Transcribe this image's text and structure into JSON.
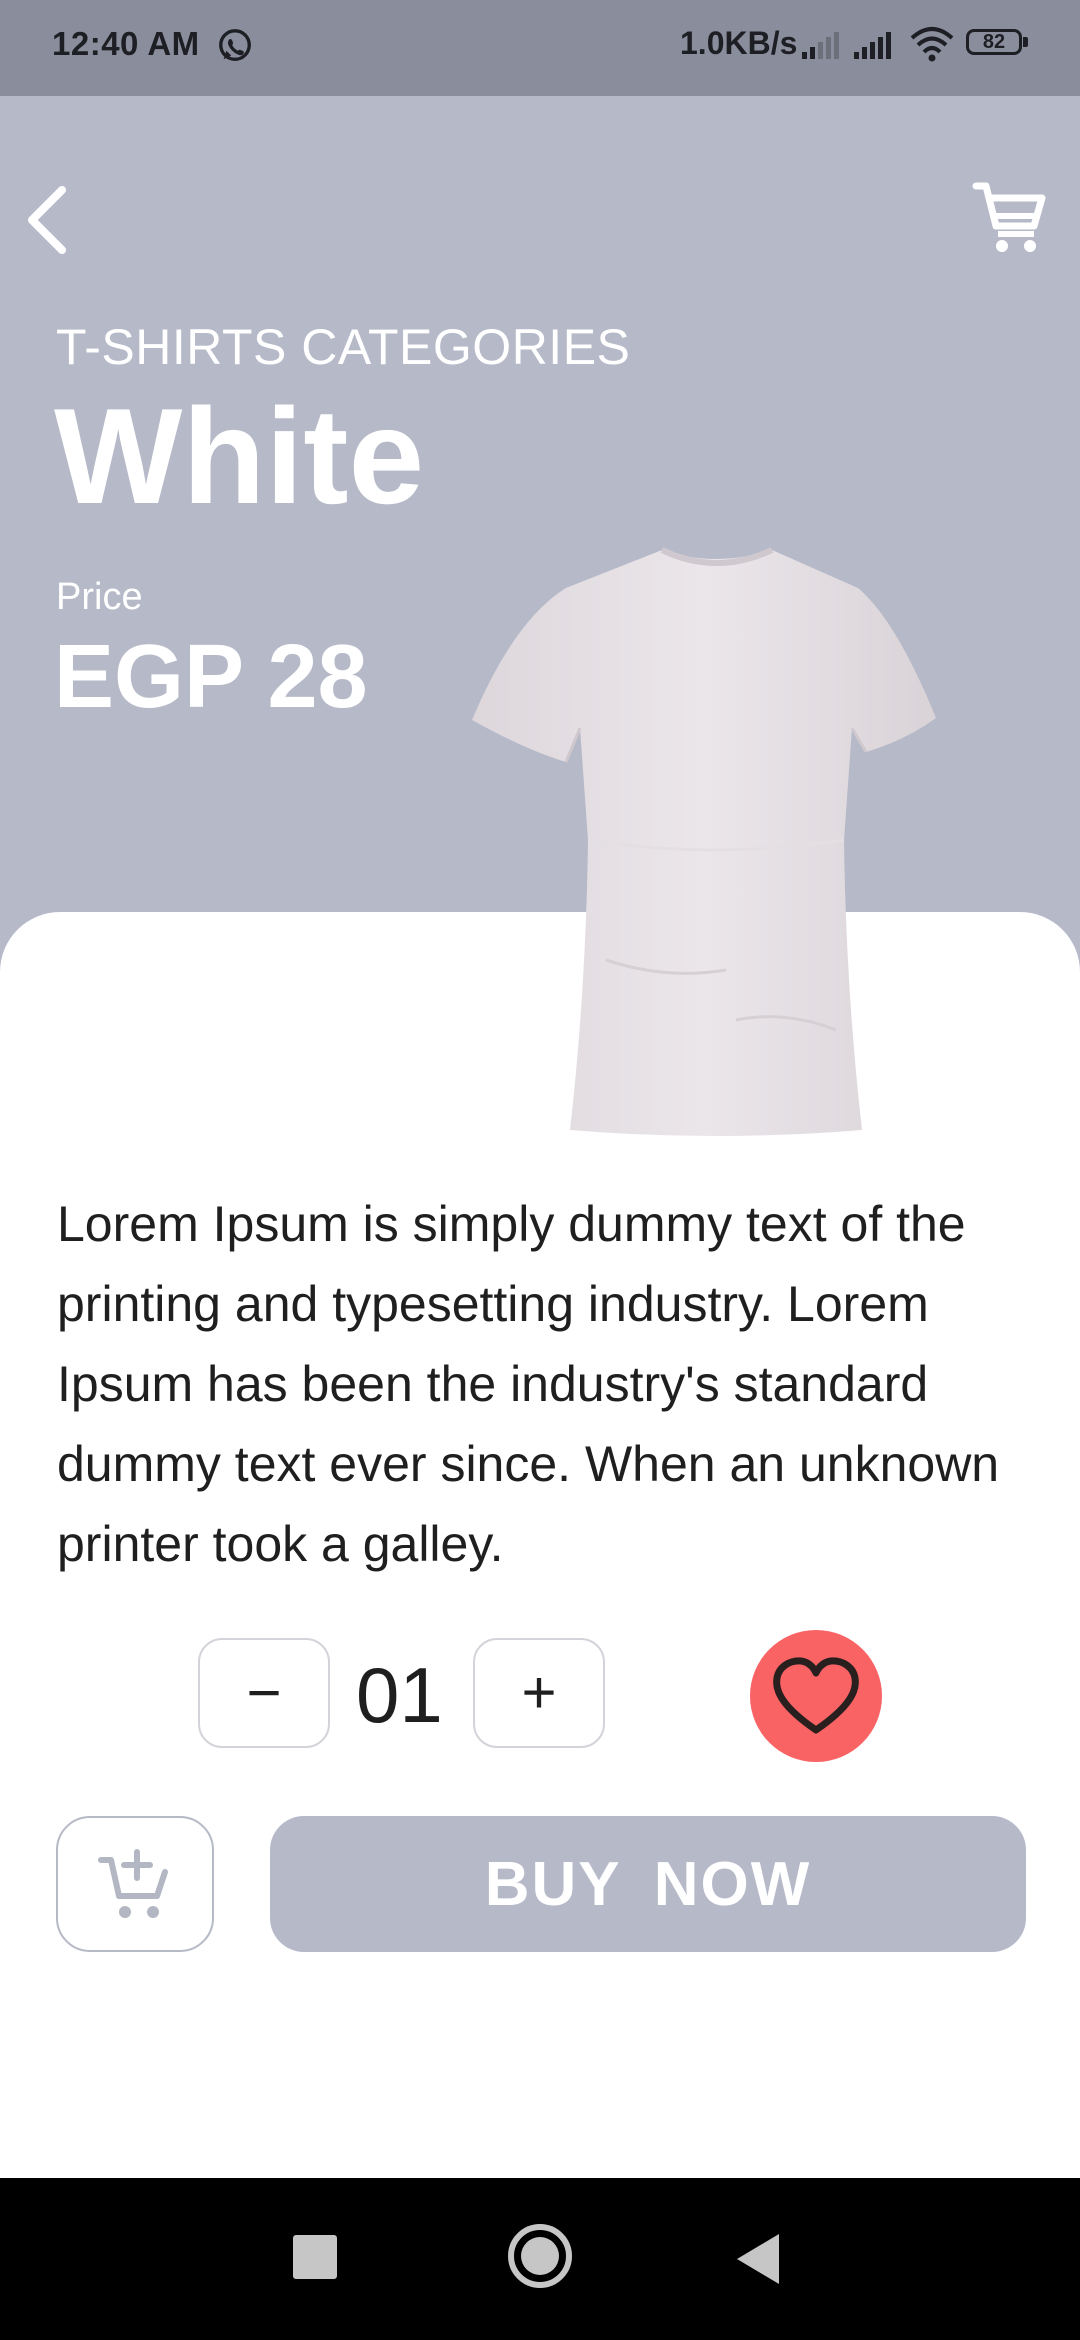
{
  "status_bar": {
    "time": "12:40 AM",
    "network_speed": "1.0KB/s",
    "battery": "82",
    "icons": [
      "whatsapp-icon",
      "signal-icon",
      "signal-icon",
      "wifi-icon",
      "battery-icon"
    ]
  },
  "header": {
    "back_icon": "chevron-left-icon",
    "cart_icon": "cart-icon"
  },
  "product": {
    "category": "T-SHIRTS CATEGORIES",
    "name": "White",
    "price_label": "Price",
    "price": "EGP 28",
    "image": "white-tshirt-back",
    "description": "Lorem Ipsum is simply dummy text of the printing and typesetting industry. Lorem Ipsum has been the industry's standard dummy text ever since. When an unknown printer took a galley."
  },
  "quantity": {
    "minus_label": "−",
    "value": "01",
    "plus_label": "+"
  },
  "actions": {
    "favorite_icon": "heart-icon",
    "add_to_cart_icon": "cart-add-icon",
    "buy_label": "BUY  NOW"
  },
  "colors": {
    "hero_bg": "#b5b9c8",
    "favorite_bg": "#fa6363",
    "buy_bg": "#b5b9c8",
    "status_bg": "#8a8d9b"
  },
  "nav_bar": {
    "icons": [
      "recent-apps-icon",
      "home-icon",
      "back-icon"
    ]
  }
}
